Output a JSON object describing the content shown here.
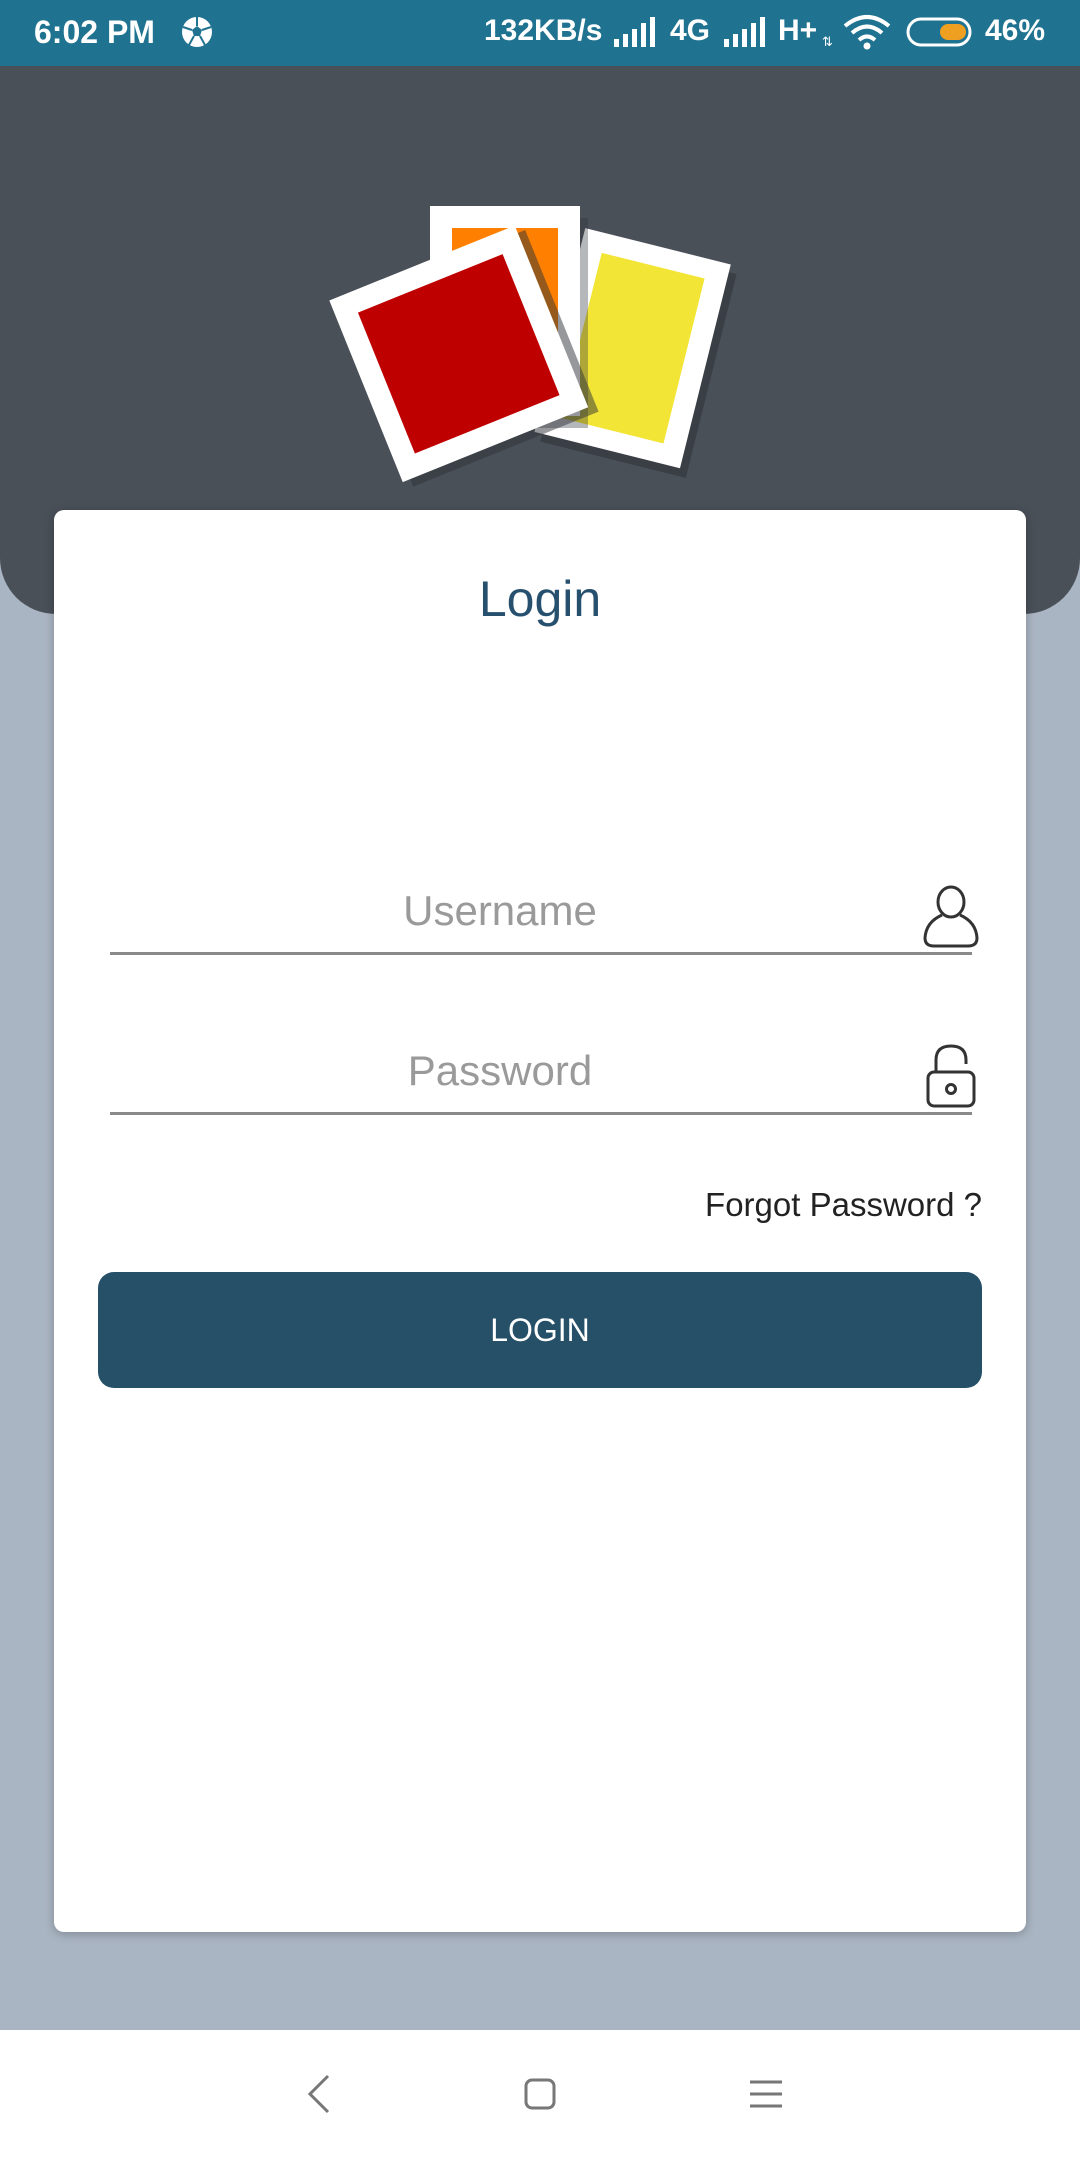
{
  "status_bar": {
    "time": "6:02 PM",
    "speed": "132KB/s",
    "network_1": "4G",
    "network_2": "H+",
    "data_arrows": "⇅",
    "battery_percent": "46%",
    "color": "#1f7290"
  },
  "header": {
    "background": "#4a5058",
    "logo_colors": [
      "#bf0000",
      "#ff8000",
      "#f3e535"
    ]
  },
  "login_card": {
    "title": "Login",
    "username_placeholder": "Username",
    "username_value": "",
    "password_placeholder": "Password",
    "password_value": "",
    "forgot_password": "Forgot Password ?",
    "login_button": "LOGIN",
    "accent": "#264f68"
  },
  "nav_bar": {
    "icons": [
      "back-icon",
      "home-icon",
      "menu-icon"
    ]
  }
}
